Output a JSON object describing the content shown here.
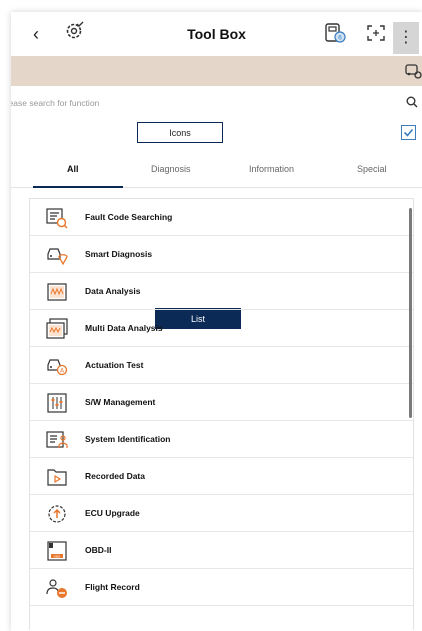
{
  "header": {
    "back_icon": "chevron-left-icon",
    "brand_icon": "gear-check-icon",
    "title": "Tool Box",
    "vci_icon": "vci-connector-icon",
    "expand_icon": "expand-icon",
    "menu_icon": "more-vertical-icon"
  },
  "banner": {
    "color": "#e4d6c8",
    "icon": "car-search-icon"
  },
  "search": {
    "placeholder": "Please search for function",
    "icon": "search-icon"
  },
  "view_switch": {
    "options": [
      "Icons",
      "List"
    ],
    "selected": "List"
  },
  "checkbox": {
    "checked": true
  },
  "tabs": [
    {
      "label": "All",
      "active": true
    },
    {
      "label": "Diagnosis",
      "active": false
    },
    {
      "label": "Information",
      "active": false
    },
    {
      "label": "Special",
      "active": false
    }
  ],
  "functions": [
    {
      "label": "Fault Code Searching",
      "icon": "fault-code-search-icon"
    },
    {
      "label": "Smart Diagnosis",
      "icon": "smart-diagnosis-icon"
    },
    {
      "label": "Data Analysis",
      "icon": "data-analysis-icon"
    },
    {
      "label": "Multi Data Analysis",
      "icon": "multi-data-analysis-icon"
    },
    {
      "label": "Actuation Test",
      "icon": "actuation-test-icon"
    },
    {
      "label": "S/W Management",
      "icon": "sw-management-icon"
    },
    {
      "label": "System Identification",
      "icon": "system-identification-icon"
    },
    {
      "label": "Recorded Data",
      "icon": "recorded-data-icon"
    },
    {
      "label": "ECU Upgrade",
      "icon": "ecu-upgrade-icon"
    },
    {
      "label": "OBD-II",
      "icon": "obd-ii-icon"
    },
    {
      "label": "Flight Record",
      "icon": "flight-record-icon"
    }
  ],
  "colors": {
    "accent": "#0b2a55",
    "icon_orange": "#e8762c",
    "checkbox": "#3b7dbd"
  }
}
